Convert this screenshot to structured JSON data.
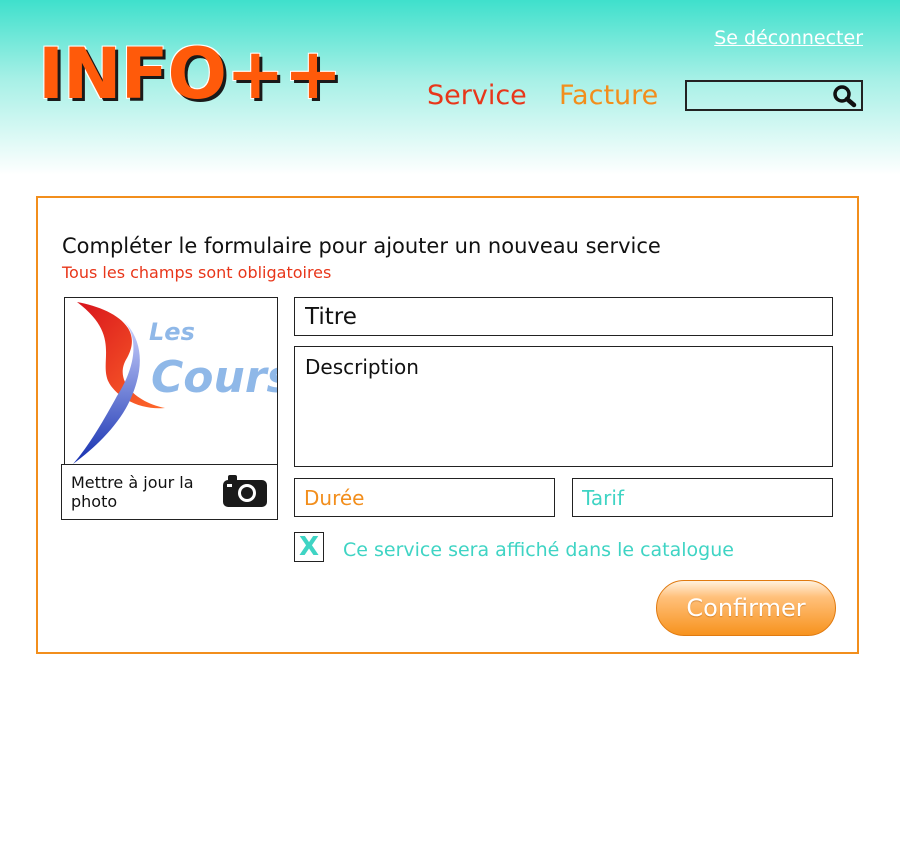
{
  "header": {
    "logo_text": "INFO++",
    "logout_label": "Se déconnecter",
    "nav": {
      "service_label": "Service",
      "facture_label": "Facture"
    },
    "search": {
      "placeholder": "",
      "icon": "search-icon"
    }
  },
  "form": {
    "title": "Compléter le formulaire pour ajouter un nouveau service",
    "subtitle": "Tous les champs sont obligatoires",
    "photo": {
      "image_text_top": "Les",
      "image_text_bottom": "Cours",
      "update_label": "Mettre à jour la photo",
      "icon": "camera-icon"
    },
    "fields": {
      "titre_placeholder": "Titre",
      "description_placeholder": "Description",
      "duree_placeholder": "Durée",
      "tarif_placeholder": "Tarif"
    },
    "catalogue": {
      "checkbox_mark": "X",
      "label": "Ce service sera affiché dans le catalogue"
    },
    "confirm_label": "Confirmer"
  },
  "colors": {
    "accent_orange": "#f28e1c",
    "accent_red": "#e8361a",
    "accent_teal": "#3fd4c4",
    "header_teal": "#3fe0cc"
  }
}
